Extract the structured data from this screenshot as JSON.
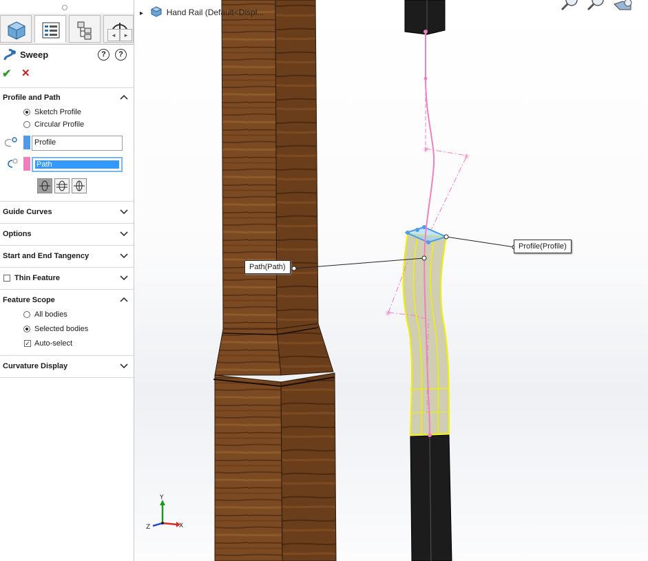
{
  "feature": {
    "title": "Sweep",
    "icon": "sweep-icon"
  },
  "tabs": [
    {
      "name": "featuremanager",
      "icon": "part-icon"
    },
    {
      "name": "propertymanager",
      "icon": "property-list-icon",
      "active": true
    },
    {
      "name": "configurationmanager",
      "icon": "config-icon"
    },
    {
      "name": "dimxpert",
      "icon": "dimxpert-icon"
    }
  ],
  "profile_and_path": {
    "heading": "Profile and Path",
    "sketch_profile": "Sketch Profile",
    "circular_profile": "Circular Profile",
    "profile_value": "Profile",
    "path_value": "Path",
    "profile_color": "#4f9be8",
    "path_color": "#f07fc0"
  },
  "sections": {
    "guide_curves": "Guide Curves",
    "options": "Options",
    "tangency": "Start and End Tangency",
    "thin_feature": "Thin Feature",
    "feature_scope": "Feature Scope",
    "curvature": "Curvature Display"
  },
  "feature_scope": {
    "all_bodies": "All bodies",
    "selected_bodies": "Selected bodies",
    "auto_select": "Auto-select"
  },
  "tree": {
    "arrow": "▸",
    "label": "Hand Rail  (Default<Displ..."
  },
  "callouts": {
    "path": "Path(Path)",
    "profile": "Profile(Profile)"
  },
  "triad": {
    "x": "X",
    "y": "Y",
    "z": "Z"
  },
  "colors": {
    "wood": "#7b4a22",
    "post": "#1c1c1c",
    "sweep_outline": "#f0f000",
    "sketch": "#f07fc0"
  }
}
